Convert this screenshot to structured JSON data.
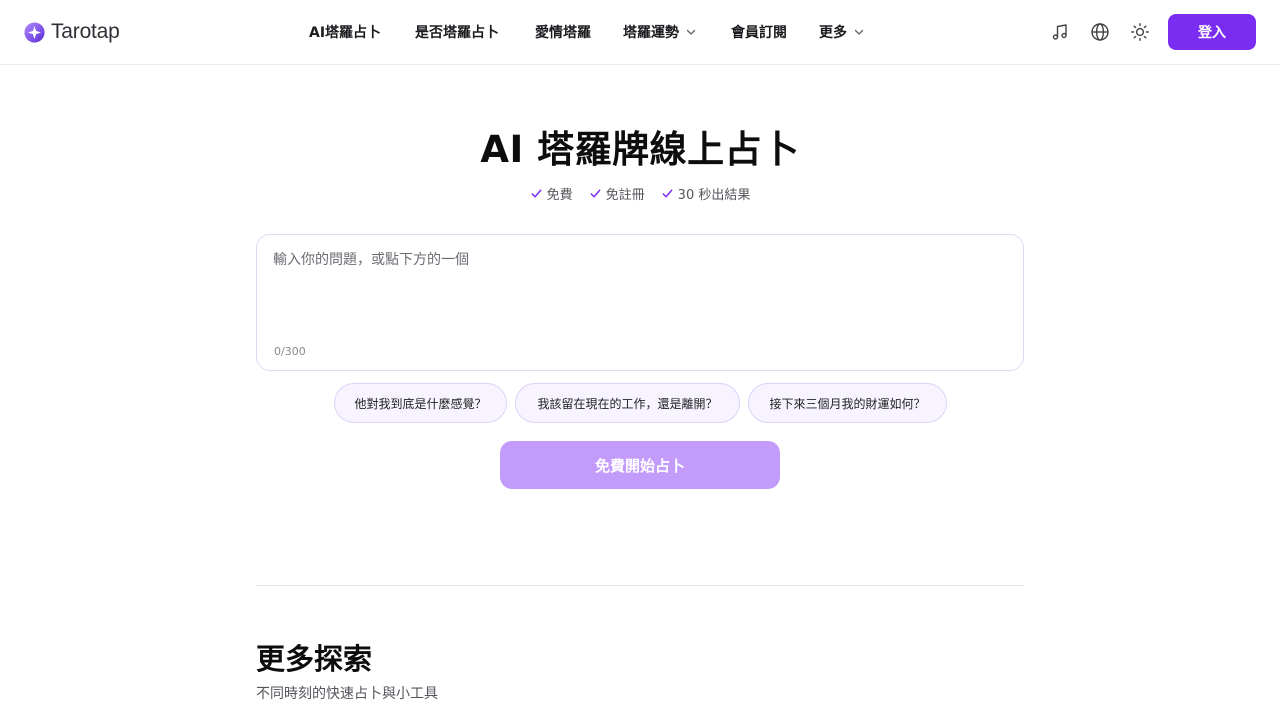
{
  "brand": {
    "name": "Tarotap",
    "accent": "#7a2cf0"
  },
  "nav": {
    "items": [
      {
        "label": "AI塔羅占卜",
        "has_dropdown": false
      },
      {
        "label": "是否塔羅占卜",
        "has_dropdown": false
      },
      {
        "label": "愛情塔羅",
        "has_dropdown": false
      },
      {
        "label": "塔羅運勢",
        "has_dropdown": true
      },
      {
        "label": "會員訂閱",
        "has_dropdown": false
      },
      {
        "label": "更多",
        "has_dropdown": true
      }
    ]
  },
  "toolbar": {
    "icons": [
      "music-icon",
      "globe-icon",
      "sun-icon"
    ],
    "login_label": "登入"
  },
  "hero": {
    "title": "AI 塔羅牌線上占卜",
    "features": [
      "免費",
      "免註冊",
      "30 秒出結果"
    ]
  },
  "question": {
    "placeholder": "輸入你的問題，或點下方的一個",
    "value": "",
    "char_count": "0/300"
  },
  "suggestions": [
    "他對我到底是什麼感覺？",
    "我該留在現在的工作，還是離開？",
    "接下來三個月我的財運如何？"
  ],
  "start_button": {
    "label": "免費開始占卜",
    "color": "#c39cfb"
  },
  "explore": {
    "title": "更多探索",
    "subtitle": "不同時刻的快速占卜與小工具"
  }
}
